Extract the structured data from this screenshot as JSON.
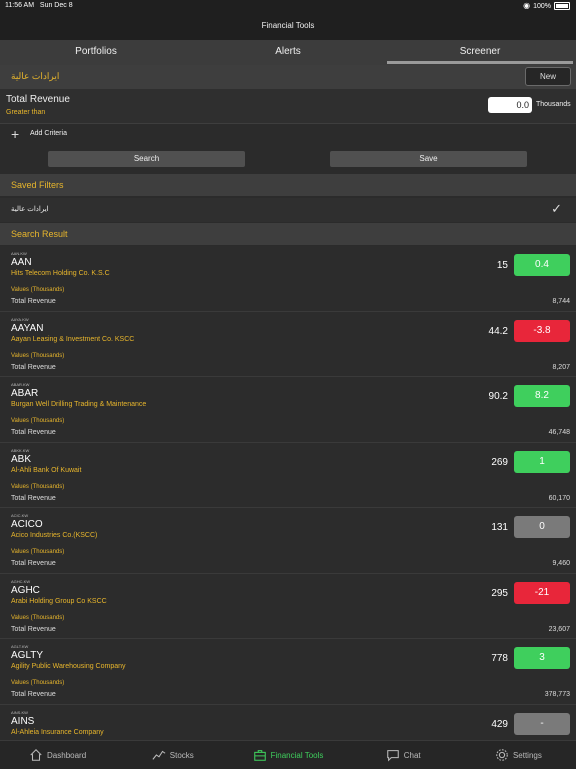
{
  "status": {
    "time": "11:56 AM",
    "date": "Sun Dec 8",
    "battery": "100%"
  },
  "nav": {
    "title": "Financial Tools"
  },
  "tabs": [
    "Portfolios",
    "Alerts",
    "Screener"
  ],
  "filter": {
    "name": "ايرادات عالية",
    "new_label": "New",
    "criteria_label": "Total Revenue",
    "operator": "Greater than",
    "value": "0.0",
    "unit": "Thousands",
    "add_label": "Add Criteria",
    "search_label": "Search",
    "save_label": "Save"
  },
  "saved": {
    "title": "Saved Filters",
    "item": "ايرادات عالية"
  },
  "results": {
    "title": "Search Result",
    "values_label": "Values (Thousands)",
    "metric_label": "Total Revenue",
    "rows": [
      {
        "code": "AAN.KW",
        "symbol": "AAN",
        "company": "Hits Telecom Holding Co. K.S.C",
        "price": "15",
        "change": "0.4",
        "status": "up",
        "revenue": "8,744"
      },
      {
        "code": "AAYA.KW",
        "symbol": "AAYAN",
        "company": "Aayan Leasing & Investment Co. KSCC",
        "price": "44.2",
        "change": "-3.8",
        "status": "down",
        "revenue": "8,207"
      },
      {
        "code": "ABAR.KW",
        "symbol": "ABAR",
        "company": "Burgan Well Drilling Trading & Maintenance",
        "price": "90.2",
        "change": "8.2",
        "status": "up",
        "revenue": "46,748"
      },
      {
        "code": "ABKK.KW",
        "symbol": "ABK",
        "company": "Al-Ahli Bank Of Kuwait",
        "price": "269",
        "change": "1",
        "status": "up",
        "revenue": "60,170"
      },
      {
        "code": "ACIC.KW",
        "symbol": "ACICO",
        "company": "Acico Industries Co.(KSCC)",
        "price": "131",
        "change": "0",
        "status": "flat",
        "revenue": "9,460"
      },
      {
        "code": "AGHC.KW",
        "symbol": "AGHC",
        "company": "Arabi Holding Group Co KSCC",
        "price": "295",
        "change": "-21",
        "status": "down",
        "revenue": "23,607"
      },
      {
        "code": "AGLT.KW",
        "symbol": "AGLTY",
        "company": "Agility Public Warehousing Company",
        "price": "778",
        "change": "3",
        "status": "up",
        "revenue": "378,773"
      },
      {
        "code": "AINS.KW",
        "symbol": "AINS",
        "company": "Al-Ahleia Insurance Company",
        "price": "429",
        "change": "-",
        "status": "flat",
        "revenue": ""
      }
    ]
  },
  "bottom_nav": [
    {
      "label": "Dashboard",
      "icon": "home-icon"
    },
    {
      "label": "Stocks",
      "icon": "chart-line-icon"
    },
    {
      "label": "Financial Tools",
      "icon": "toolbox-icon",
      "active": true
    },
    {
      "label": "Chat",
      "icon": "chat-bubble-icon"
    },
    {
      "label": "Settings",
      "icon": "gear-icon"
    }
  ],
  "colors": {
    "accent": "#e8b62c",
    "up": "#3fcf5d",
    "down": "#e8263a",
    "flat": "#7a7a7a"
  }
}
